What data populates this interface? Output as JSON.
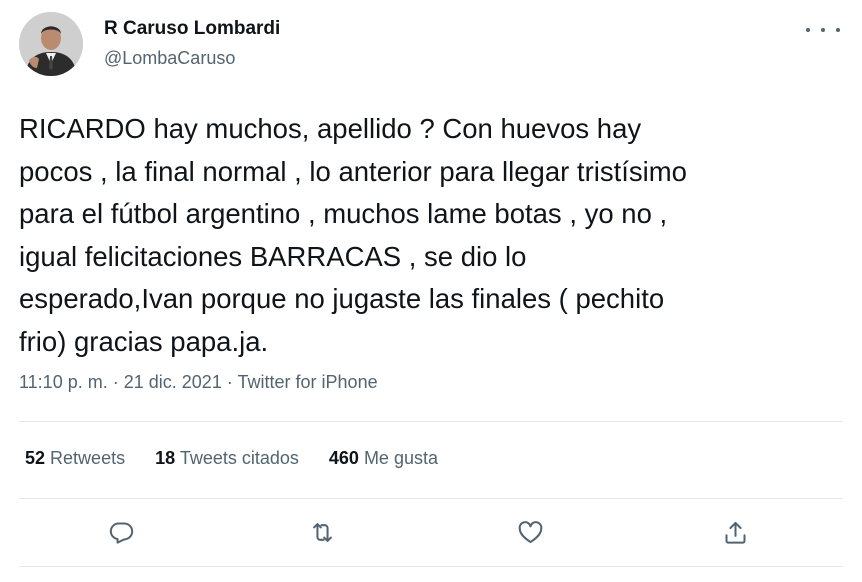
{
  "author": {
    "name": "R Caruso Lombardi",
    "handle": "@LombaCaruso"
  },
  "icons": {
    "more": "more-horizontal-icon",
    "reply": "reply-icon",
    "retweet": "retweet-icon",
    "like": "heart-icon",
    "share": "share-icon"
  },
  "tweet": {
    "text": "RICARDO hay muchos, apellido ? Con huevos hay\npocos , la final normal , lo anterior para llegar tristísimo\npara el fútbol argentino , muchos lame botas , yo no ,\nigual felicitaciones BARRACAS , se dio lo\nesperado,Ivan porque no jugaste las finales ( pechito\nfrio) gracias papa.ja.",
    "time": "11:10 p. m.",
    "separator": "·",
    "date": "21 dic. 2021",
    "source": "Twitter for iPhone"
  },
  "stats": {
    "retweets": {
      "count": "52",
      "label": "Retweets"
    },
    "quotes": {
      "count": "18",
      "label": "Tweets citados"
    },
    "likes": {
      "count": "460",
      "label": "Me gusta"
    }
  },
  "colors": {
    "text": "#0f1419",
    "secondary": "#536471",
    "divider": "#e6e9ec"
  }
}
